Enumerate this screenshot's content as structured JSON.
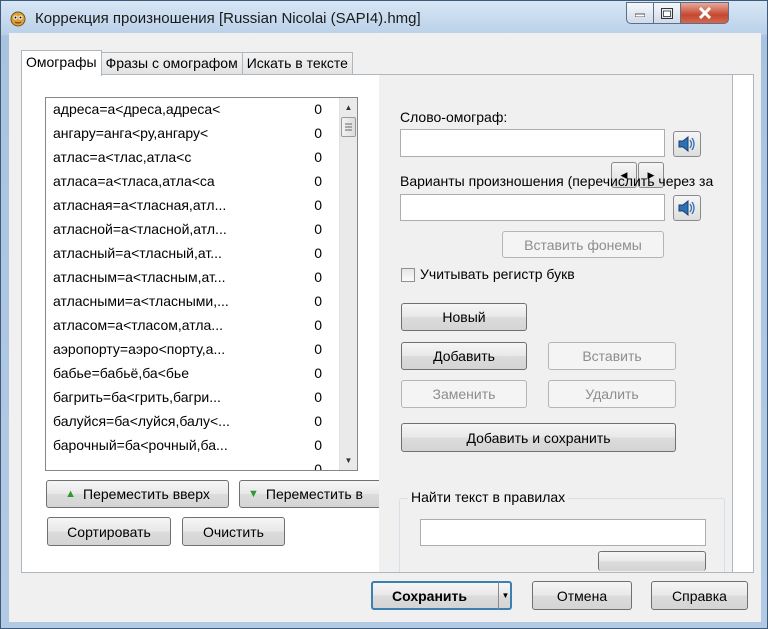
{
  "window": {
    "title": "Коррекция произношения [Russian Nicolai (SAPI4).hmg]"
  },
  "tabs": [
    {
      "label": "Омографы",
      "active": true
    },
    {
      "label": "Фразы с омографом",
      "active": false
    },
    {
      "label": "Искать в тексте",
      "active": false
    }
  ],
  "homograph_list": [
    {
      "text": "адреса=а<дреса,адреса<",
      "count": "0"
    },
    {
      "text": "ангару=анга<ру,ангару<",
      "count": "0"
    },
    {
      "text": "атлас=а<тлас,атла<с",
      "count": "0"
    },
    {
      "text": "атласа=а<тласа,атла<са",
      "count": "0"
    },
    {
      "text": "атласная=а<тласная,атл...",
      "count": "0"
    },
    {
      "text": "атласной=а<тласной,атл...",
      "count": "0"
    },
    {
      "text": "атласный=а<тласный,ат...",
      "count": "0"
    },
    {
      "text": "атласным=а<тласным,ат...",
      "count": "0"
    },
    {
      "text": "атласными=а<тласными,...",
      "count": "0"
    },
    {
      "text": "атласом=а<тласом,атла...",
      "count": "0"
    },
    {
      "text": "аэропорту=аэро<порту,а...",
      "count": "0"
    },
    {
      "text": "бабье=бабьё,ба<бье",
      "count": "0"
    },
    {
      "text": "багрить=ба<грить,багри...",
      "count": "0"
    },
    {
      "text": "балуйся=ба<луйся,балу<...",
      "count": "0"
    },
    {
      "text": "барочный=ба<рочный,ба...",
      "count": "0"
    },
    {
      "text": "",
      "count": "0"
    }
  ],
  "left_buttons": {
    "move_up": "Переместить вверх",
    "move_down": "Переместить в",
    "sort": "Сортировать",
    "clear": "Очистить"
  },
  "right_panel": {
    "homograph_label": "Слово-омограф:",
    "homograph_value": "",
    "variants_label": "Варианты произношения (перечислить через за",
    "variants_value": "",
    "insert_phonemes": "Вставить фонемы",
    "case_checkbox_label": "Учитывать регистр букв",
    "case_checked": false,
    "new": "Новый",
    "add": "Добавить",
    "insert": "Вставить",
    "replace": "Заменить",
    "delete": "Удалить",
    "add_and_save": "Добавить и сохранить",
    "find_group_title": "Найти текст в правилах",
    "find_value": ""
  },
  "footer": {
    "save": "Сохранить",
    "cancel": "Отмена",
    "help": "Справка"
  },
  "colors": {
    "accent_green": "#2c9a2c",
    "close_red": "#c5482f"
  }
}
